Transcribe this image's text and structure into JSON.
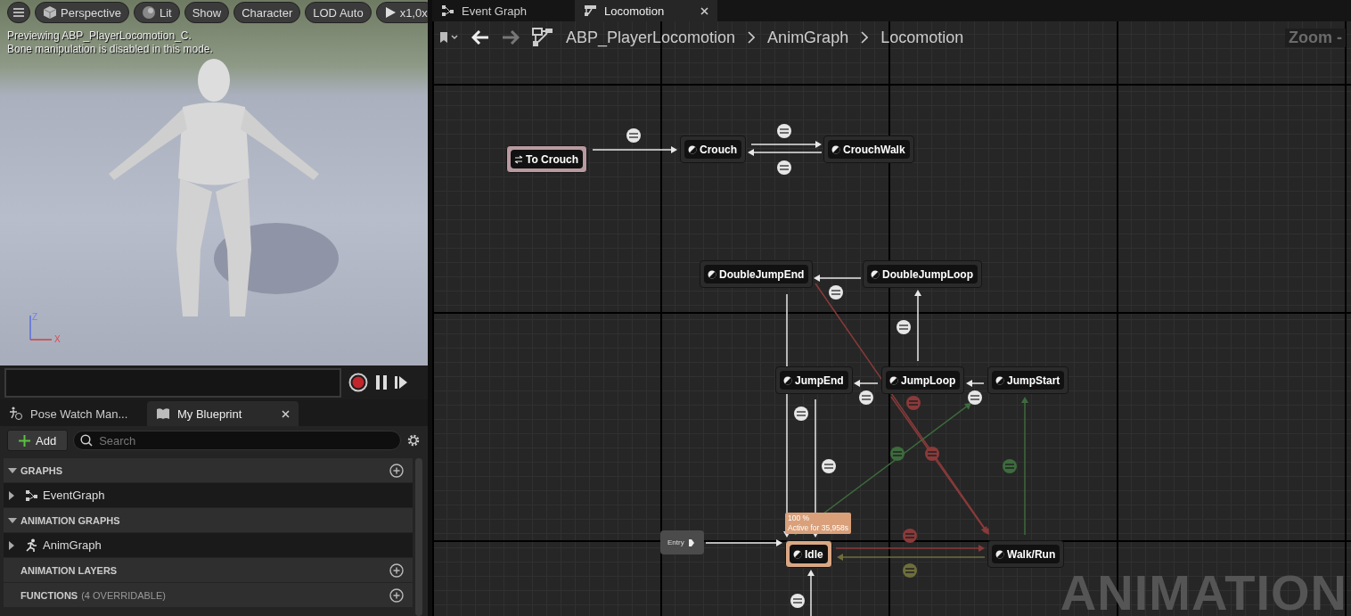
{
  "viewport": {
    "toolbar": [
      {
        "kind": "cube",
        "label": "Perspective"
      },
      {
        "kind": "sphere",
        "label": "Lit"
      },
      {
        "kind": "plain",
        "label": "Show"
      },
      {
        "kind": "plain",
        "label": "Character"
      },
      {
        "kind": "plain",
        "label": "LOD Auto"
      },
      {
        "kind": "play",
        "label": "x1,0x"
      }
    ],
    "overlay_lines": [
      "Previewing ABP_PlayerLocomotion_C.",
      "Bone manipulation is disabled in this mode."
    ],
    "axis_labels": [
      "Z",
      "X"
    ]
  },
  "panel_tabs": [
    {
      "label": "Pose Watch Man...",
      "selected": false
    },
    {
      "label": "My Blueprint",
      "selected": true
    }
  ],
  "add_button": "Add",
  "search": {
    "placeholder": "Search"
  },
  "sections": [
    {
      "title": "GRAPHS",
      "expanded": true,
      "addable": true,
      "items": [
        {
          "label": "EventGraph",
          "kind": "event",
          "expanded": false
        }
      ]
    },
    {
      "title": "ANIMATION GRAPHS",
      "expanded": true,
      "addable": false,
      "items": [
        {
          "label": "AnimGraph",
          "kind": "anim",
          "expanded": false
        }
      ]
    },
    {
      "title": "ANIMATION LAYERS",
      "expanded": false,
      "addable": true
    },
    {
      "title": "FUNCTIONS",
      "note": "(4 OVERRIDABLE)",
      "expanded": false,
      "addable": true
    }
  ],
  "graph_tabs": [
    {
      "label": "Event Graph",
      "kind": "event",
      "selected": false
    },
    {
      "label": "Locomotion",
      "kind": "state_machine",
      "selected": true
    }
  ],
  "breadcrumbs": [
    "ABP_PlayerLocomotion",
    "AnimGraph",
    "Locomotion"
  ],
  "zoom_label": "Zoom -",
  "graph": {
    "watermark": "ANIMATION",
    "nodes": [
      {
        "label": "To Crouch",
        "kind": "conduit",
        "active": false
      },
      {
        "label": "Crouch",
        "kind": "state",
        "active": false
      },
      {
        "label": "CrouchWalk",
        "kind": "state",
        "active": false
      },
      {
        "label": "DoubleJumpEnd",
        "kind": "state",
        "active": false
      },
      {
        "label": "DoubleJumpLoop",
        "kind": "state",
        "active": false
      },
      {
        "label": "JumpEnd",
        "kind": "state",
        "active": false
      },
      {
        "label": "JumpLoop",
        "kind": "state",
        "active": false
      },
      {
        "label": "JumpStart",
        "kind": "state",
        "active": false
      },
      {
        "label": "Entry",
        "kind": "entry",
        "active": false
      },
      {
        "label": "Idle",
        "kind": "state",
        "active": true
      },
      {
        "label": "Walk/Run",
        "kind": "state",
        "active": false
      }
    ],
    "active_info": {
      "weight": "100 %",
      "time": "Active for 35,958s"
    }
  }
}
